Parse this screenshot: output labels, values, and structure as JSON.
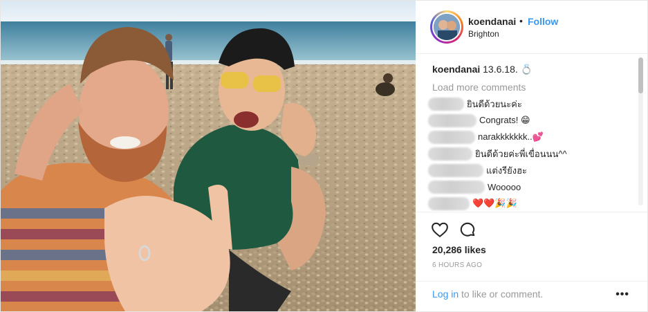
{
  "post": {
    "username": "koendanai",
    "follow_label": "Follow",
    "separator": "•",
    "location": "Brighton",
    "caption_user": "koendanai",
    "caption_text": "13.6.18. 💍",
    "load_more": "Load more comments",
    "comments": [
      {
        "text": "ยินดีด้วยนะค่ะ"
      },
      {
        "text": "Congrats! 😁"
      },
      {
        "text": "narakkkkkkk..💕"
      },
      {
        "text": "ยินดีด้วยค่ะพี่เขื่อนนน^^"
      },
      {
        "text": "แต่งรียังฮะ"
      },
      {
        "text": "Wooooo"
      },
      {
        "text": "❤️❤️🎉🎉"
      }
    ],
    "likes": "20,286 likes",
    "time": "6 HOURS AGO",
    "login_link": "Log in",
    "login_rest": " to like or comment.",
    "more_label": "•••"
  },
  "icons": {
    "like": "heart-icon",
    "comment": "comment-bubble-icon",
    "more": "more-options-icon"
  },
  "colors": {
    "accent": "#3897f0",
    "secondary_text": "#999999",
    "primary_text": "#262626"
  }
}
